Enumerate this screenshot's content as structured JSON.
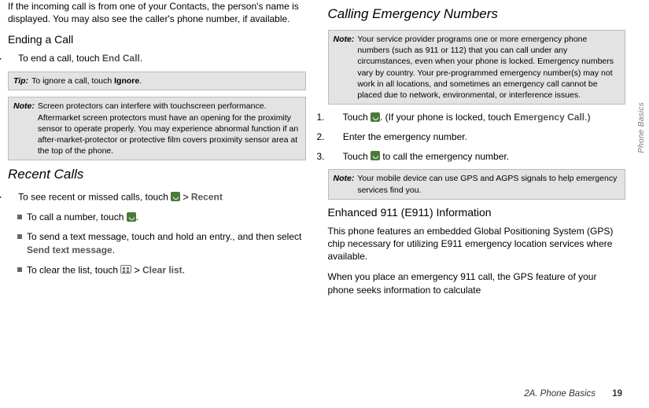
{
  "left": {
    "intro": "If the incoming call is from one of your Contacts, the person's name is displayed. You may also see the caller's phone number, if available.",
    "heading_ending": "Ending a Call",
    "ending_step_prefix": "To end a call, touch ",
    "ending_step_bold": "End Call",
    "ending_step_suffix": ".",
    "tip_label": "Tip:",
    "tip_text_prefix": "To ignore a call, touch ",
    "tip_text_bold": "Ignore",
    "tip_text_suffix": ".",
    "note1_label": "Note:",
    "note1_text": "Screen protectors can interfere with touchscreen performance. Aftermarket screen protectors must have an opening for the proximity sensor to operate properly. You may experience abnormal function if an after-market-protector or protective film covers proximity sensor area at the top of the phone.",
    "heading_recent": "Recent Calls",
    "recent_step_prefix": "To see recent or missed calls, touch ",
    "recent_step_bold": "Recent",
    "sub1_prefix": "To call a number, touch ",
    "sub1_suffix": ".",
    "sub2_prefix": "To send a text message, touch and hold an entry., and then select ",
    "sub2_bold": "Send text message",
    "sub2_suffix": ".",
    "sub3_prefix": "To clear the list, touch ",
    "sub3_bold": "Clear list",
    "sub3_suffix": "."
  },
  "right": {
    "heading_emergency": "Calling Emergency Numbers",
    "note2_label": "Note:",
    "note2_text": "Your service provider programs one or more emergency phone numbers (such as 911 or 112) that you can call under any circumstances, even when your phone is locked. Emergency numbers vary by country. Your pre-programmed emergency number(s) may not work in all locations, and sometimes an emergency call cannot be placed due to network, environmental, or interference issues.",
    "ol1_prefix": "Touch ",
    "ol1_mid": ". (If your phone is locked, touch ",
    "ol1_bold": "Emergency Call",
    "ol1_suffix": ".)",
    "ol2": "Enter the emergency number.",
    "ol3_prefix": "Touch ",
    "ol3_suffix": " to call the emergency number.",
    "note3_label": "Note:",
    "note3_text": "Your mobile device can use GPS and AGPS signals to help emergency services find you.",
    "heading_e911": "Enhanced 911 (E911) Information",
    "p_e911_1": "This phone features an embedded Global Positioning System (GPS) chip necessary for utilizing E911 emergency location services where available.",
    "p_e911_2": "When you place an emergency 911 call, the GPS feature of your phone seeks information to calculate"
  },
  "side_tab": "Phone Basics",
  "footer_section": "2A. Phone Basics",
  "footer_page": "19"
}
